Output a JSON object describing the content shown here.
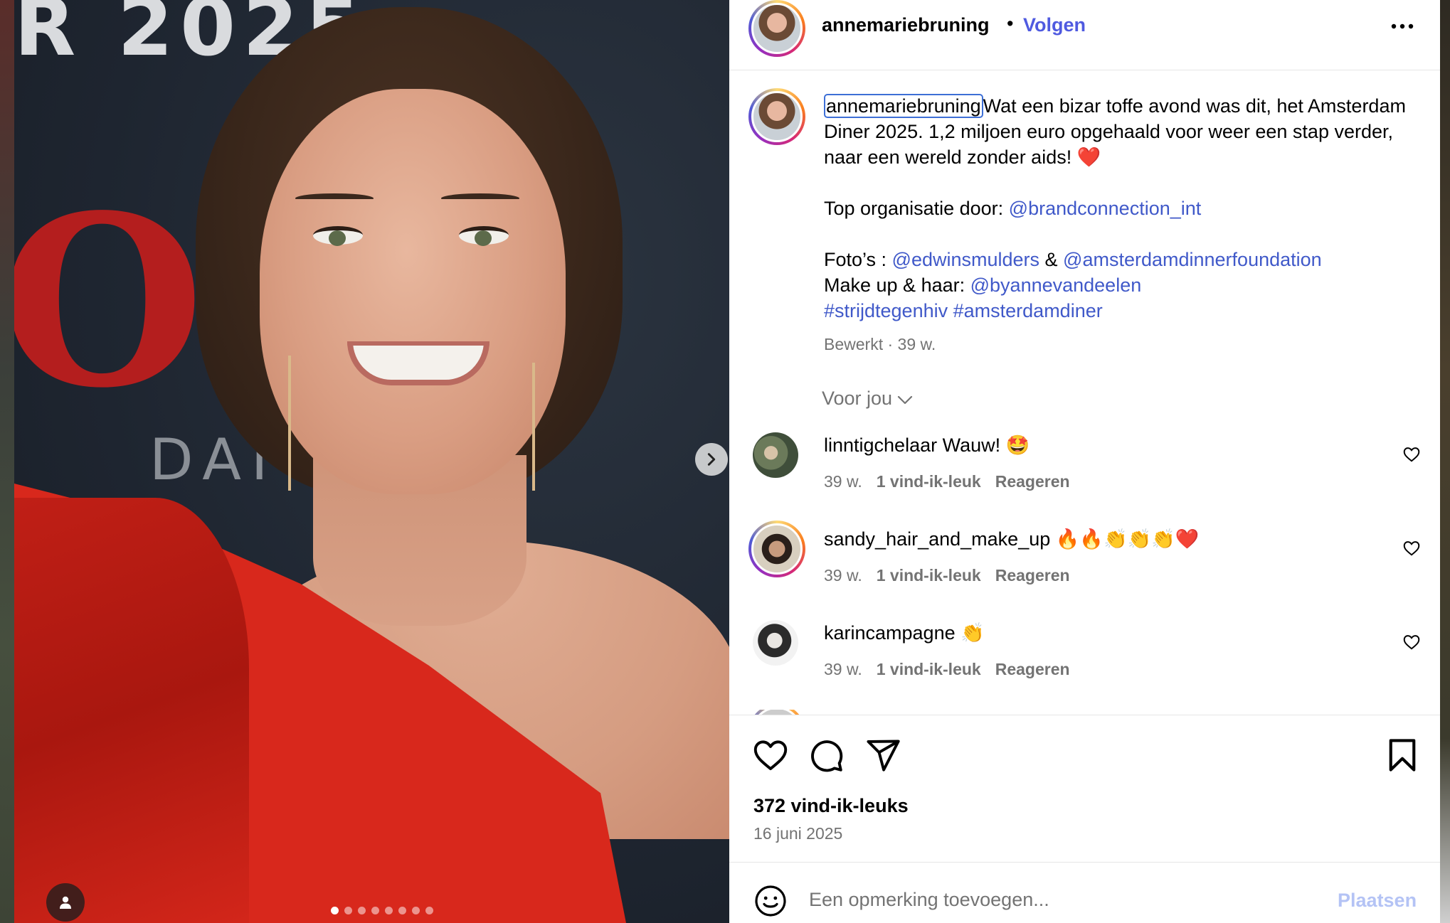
{
  "photo": {
    "background_text_top": "R 2025",
    "background_text_red": "Ou",
    "background_text_gray": "DAI",
    "carousel_dots_count": 8,
    "carousel_active_index": 0,
    "next_icon": "chevron-right-icon",
    "user_tag_icon": "person-icon"
  },
  "header": {
    "username": "annemariebruning",
    "separator": "•",
    "follow_label": "Volgen",
    "more_icon": "more-horizontal-icon"
  },
  "caption": {
    "username": "annemariebruning",
    "line1": "Wat een bizar toffe avond was dit, het Amsterdam Diner 2025. 1,2 miljoen euro opgehaald voor weer een stap verder, naar een wereld zonder aids! ❤️",
    "org_prefix": "Top organisatie door: ",
    "org_link": "@brandconnection_int",
    "photos_prefix": "Foto’s : ",
    "photos_link1": "@edwinsmulders",
    "photos_and": " & ",
    "photos_link2": "@amsterdamdinnerfoundation",
    "makeup_prefix": "Make up & haar: ",
    "makeup_link": "@byannevandeelen",
    "hashtag1": "#strijdtegenhiv",
    "hashtag2": "#amsterdamdiner",
    "meta": "Bewerkt · 39 w."
  },
  "for_you": {
    "label": "Voor jou"
  },
  "comments": [
    {
      "username": "linntigchelaar",
      "text": "Wauw! 🤩",
      "age": "39 w.",
      "likes": "1 vind-ik-leuk",
      "reply": "Reageren"
    },
    {
      "username": "sandy_hair_and_make_up",
      "text": "🔥🔥👏👏👏❤️",
      "age": "39 w.",
      "likes": "1 vind-ik-leuk",
      "reply": "Reageren"
    },
    {
      "username": "karincampagne",
      "text": "👏",
      "age": "39 w.",
      "likes": "1 vind-ik-leuk",
      "reply": "Reageren"
    }
  ],
  "actions": {
    "like_icon": "heart-icon",
    "comment_icon": "comment-icon",
    "share_icon": "share-icon",
    "save_icon": "bookmark-icon",
    "likes_count": "372 vind-ik-leuks",
    "date": "16 juni 2025"
  },
  "comment_input": {
    "placeholder": "Een opmerking toevoegen...",
    "post_label": "Plaatsen",
    "emoji_icon": "emoji-icon"
  },
  "colors": {
    "link": "#4059c9",
    "follow": "#4f5ae0",
    "post_disabled": "#b4c3f5",
    "meta_gray": "#737373",
    "dress_red": "#d8281c"
  }
}
